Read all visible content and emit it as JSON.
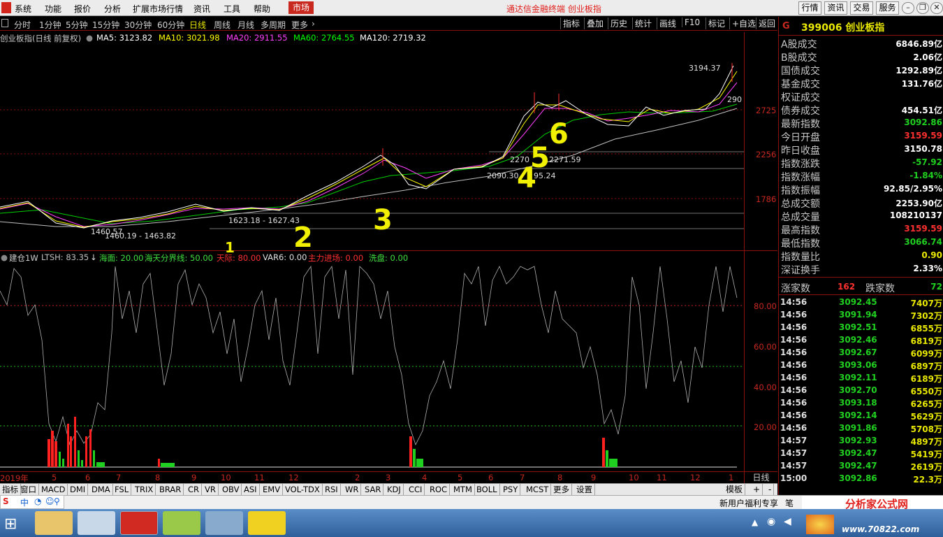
{
  "menu": {
    "items": [
      "系统",
      "功能",
      "报价",
      "分析",
      "扩展市场行情",
      "资讯",
      "工具",
      "帮助"
    ],
    "market_tab": "市场",
    "app_title": "通达信金融终端  创业板指",
    "right_buttons": [
      "行情",
      "资讯",
      "交易",
      "服务"
    ]
  },
  "period": {
    "items": [
      "分时",
      "1分钟",
      "5分钟",
      "15分钟",
      "30分钟",
      "60分钟",
      "日线",
      "周线",
      "月线",
      "多周期",
      "更多"
    ],
    "active": "日线",
    "tools": [
      "指标",
      "叠加",
      "历史",
      "统计",
      "画线",
      "F10",
      "标记",
      "+自选",
      "返回"
    ]
  },
  "ma": {
    "title": "创业板指(日线 前复权)",
    "ma5": "MA5: 3123.82",
    "ma10": "MA10: 3021.98",
    "ma20": "MA20: 2911.55",
    "ma60": "MA60: 2764.55",
    "ma120": "MA120: 2719.32",
    "colors": {
      "ma5": "#ffffff",
      "ma10": "#ffff00",
      "ma20": "#ff40ff",
      "ma60": "#00ff00",
      "ma120": "#ffffff"
    }
  },
  "price_axis": {
    "labels": [
      "2725",
      "2256",
      "1786"
    ]
  },
  "chart_labels": {
    "high_label": "3194.37",
    "right_label": "290",
    "l1": "1623.18 - 1627.43",
    "l2": "1460.19 - 1463.82",
    "l3": "2270",
    "l4": "2271.59",
    "l5": "2090.30",
    "l6": "95.24",
    "l7": "1460.57"
  },
  "wave_numbers": [
    "1",
    "2",
    "3",
    "4",
    "5",
    "6"
  ],
  "indicator": {
    "name": "建仓1W",
    "ltsh": "LTSH: 83.35",
    "haimian": "海面: 20.00",
    "haitian": "海天分界线: 50.00",
    "tianjie": "天际: 80.00",
    "var6": "VAR6: 0.00",
    "zhuli": "主力进场: 0.00",
    "xipan": "洗盘: 0.00",
    "axis": [
      "80.00",
      "60.00",
      "40.00",
      "20.00"
    ]
  },
  "months": [
    "2019年",
    "5",
    "6",
    "7",
    "8",
    "9",
    "10",
    "11",
    "12",
    "2",
    "3",
    "4",
    "5",
    "6",
    "7",
    "8",
    "9",
    "10",
    "11",
    "12",
    "1"
  ],
  "day_button": "日线",
  "ind_tabs": [
    "指标",
    "窗口",
    "MACD",
    "DMI",
    "DMA",
    "FSL",
    "TRIX",
    "BRAR",
    "CR",
    "VR",
    "OBV",
    "ASI",
    "EMV",
    "VOL-TDX",
    "RSI",
    "WR",
    "SAR",
    "KDJ",
    "CCI",
    "ROC",
    "MTM",
    "BOLL",
    "PSY",
    "MCST",
    "更多",
    "设置"
  ],
  "ind_tabs_right": [
    "模板",
    "+",
    "-"
  ],
  "panel": {
    "g": "G",
    "code": "399006 创业板指",
    "stats": [
      {
        "k": "A股成交",
        "v": "6846.89亿",
        "c": "wht"
      },
      {
        "k": "B股成交",
        "v": "2.06亿",
        "c": "wht"
      },
      {
        "k": "国债成交",
        "v": "1292.89亿",
        "c": "wht"
      },
      {
        "k": "基金成交",
        "v": "131.76亿",
        "c": "wht"
      },
      {
        "k": "权证成交",
        "v": "",
        "c": "wht"
      },
      {
        "k": "债券成交",
        "v": "454.51亿",
        "c": "wht"
      },
      {
        "k": "最新指数",
        "v": "3092.86",
        "c": "grn"
      },
      {
        "k": "今日开盘",
        "v": "3159.59",
        "c": "red"
      },
      {
        "k": "昨日收盘",
        "v": "3150.78",
        "c": "wht"
      },
      {
        "k": "指数涨跌",
        "v": "-57.92",
        "c": "grn"
      },
      {
        "k": "指数涨幅",
        "v": "-1.84%",
        "c": "grn"
      },
      {
        "k": "指数振幅",
        "v": "92.85/2.95%",
        "c": "wht"
      },
      {
        "k": "总成交额",
        "v": "2253.90亿",
        "c": "wht"
      },
      {
        "k": "总成交量",
        "v": "108210137",
        "c": "wht"
      },
      {
        "k": "最高指数",
        "v": "3159.59",
        "c": "red"
      },
      {
        "k": "最低指数",
        "v": "3066.74",
        "c": "grn"
      },
      {
        "k": "指数量比",
        "v": "0.90",
        "c": "yel"
      },
      {
        "k": "深证换手",
        "v": "2.33%",
        "c": "wht"
      }
    ],
    "rise_label": "涨家数",
    "rise_val": "162",
    "fall_label": "跌家数",
    "fall_val": "72",
    "ticks": [
      {
        "t": "14:56",
        "p": "3092.45",
        "v": "7407万"
      },
      {
        "t": "14:56",
        "p": "3091.94",
        "v": "7302万"
      },
      {
        "t": "14:56",
        "p": "3092.51",
        "v": "6855万"
      },
      {
        "t": "14:56",
        "p": "3092.46",
        "v": "6819万"
      },
      {
        "t": "14:56",
        "p": "3092.67",
        "v": "6099万"
      },
      {
        "t": "14:56",
        "p": "3093.06",
        "v": "6897万"
      },
      {
        "t": "14:56",
        "p": "3092.11",
        "v": "6189万"
      },
      {
        "t": "14:56",
        "p": "3092.70",
        "v": "6550万"
      },
      {
        "t": "14:56",
        "p": "3093.18",
        "v": "6265万"
      },
      {
        "t": "14:56",
        "p": "3092.14",
        "v": "5629万"
      },
      {
        "t": "14:56",
        "p": "3091.86",
        "v": "5708万"
      },
      {
        "t": "14:57",
        "p": "3092.93",
        "v": "4897万"
      },
      {
        "t": "14:57",
        "p": "3092.47",
        "v": "5419万"
      },
      {
        "t": "14:57",
        "p": "3092.47",
        "v": "2619万"
      },
      {
        "t": "15:00",
        "p": "3092.86",
        "v": "22.3万"
      }
    ]
  },
  "status": {
    "new_user": "新用户福利专享",
    "pen": "笔"
  },
  "ime": {
    "zh": "中"
  },
  "watermark": {
    "name": "分析家公式网",
    "url": "www.70822.com"
  }
}
